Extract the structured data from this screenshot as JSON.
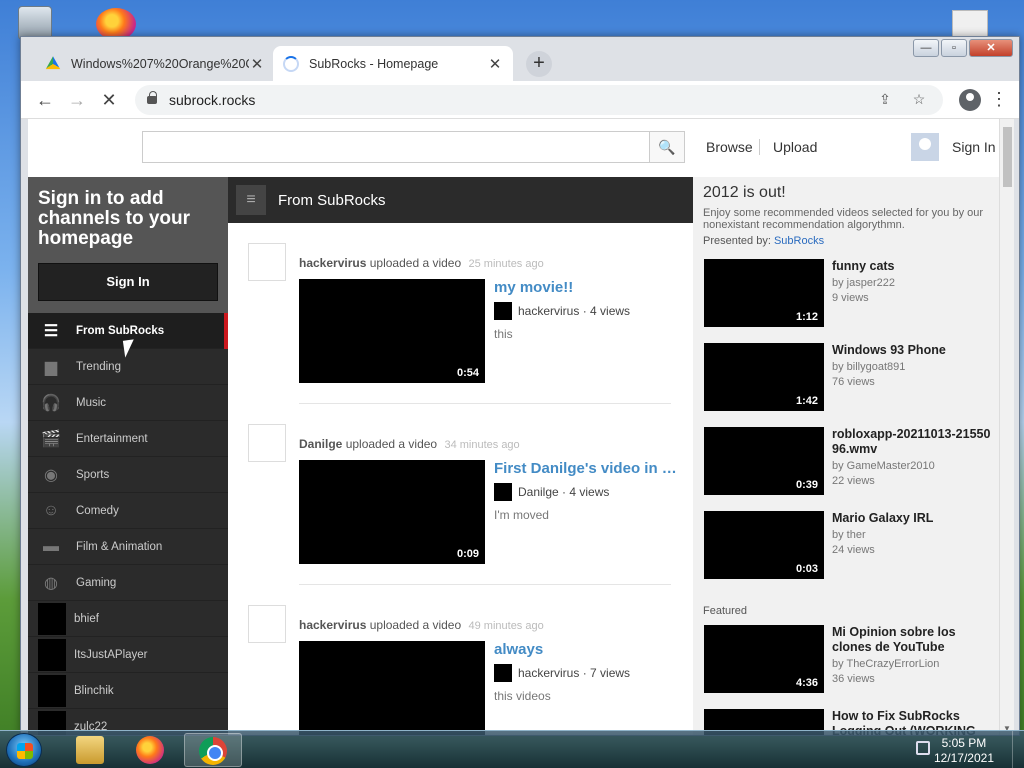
{
  "browser": {
    "tabs": [
      {
        "title": "Windows%207%20Orange%20C",
        "close": "✕"
      },
      {
        "title": "SubRocks - Homepage",
        "close": "✕"
      }
    ],
    "new_tab": "+",
    "url": "subrock.rocks",
    "back": "←",
    "forward": "→",
    "reload": "✕",
    "share": "⇪",
    "bookmark": "☆",
    "menu": "⋮",
    "window_controls": {
      "minimize": "—",
      "maximize": "▫",
      "close": "✕"
    }
  },
  "masthead": {
    "search_placeholder": "",
    "search_icon": "🔍",
    "browse": "Browse",
    "upload": "Upload",
    "sign_in": "Sign In"
  },
  "guide": {
    "heading": "Sign in to add channels to your homepage",
    "sign_in_button": "Sign In",
    "items": [
      {
        "label": "From SubRocks",
        "icon": "list-icon",
        "glyph": "☰"
      },
      {
        "label": "Trending",
        "icon": "trending-icon",
        "glyph": "▆"
      },
      {
        "label": "Music",
        "icon": "headphones-icon",
        "glyph": "🎧"
      },
      {
        "label": "Entertainment",
        "icon": "clapper-icon",
        "glyph": "🎬"
      },
      {
        "label": "Sports",
        "icon": "football-icon",
        "glyph": "◉"
      },
      {
        "label": "Comedy",
        "icon": "mask-icon",
        "glyph": "☺"
      },
      {
        "label": "Film & Animation",
        "icon": "film-icon",
        "glyph": "▬"
      },
      {
        "label": "Gaming",
        "icon": "gamepad-icon",
        "glyph": "◍"
      }
    ],
    "channels": [
      "bhief",
      "ItsJustAPlayer",
      "Blinchik",
      "zulc22"
    ]
  },
  "feed": {
    "title": "From SubRocks",
    "items": [
      {
        "user": "hackervirus",
        "action": "uploaded a video",
        "time": "25 minutes ago",
        "duration": "0:54",
        "title": "my movie!!",
        "author": "hackervirus",
        "views": "4 views",
        "description": "this"
      },
      {
        "user": "Danilge",
        "action": "uploaded a video",
        "time": "34 minutes ago",
        "duration": "0:09",
        "title": "First Danilge's video in SubRocks",
        "author": "Danilge",
        "views": "4 views",
        "description": "I'm moved"
      },
      {
        "user": "hackervirus",
        "action": "uploaded a video",
        "time": "49 minutes ago",
        "duration": "",
        "title": "always",
        "author": "hackervirus",
        "views": "7 views",
        "description": "this videos"
      }
    ]
  },
  "side": {
    "heading": "2012 is out!",
    "intro": "Enjoy some recommended videos selected for you by our nonexistant recommendation algorythmn.",
    "presented_label": "Presented by:",
    "presented_by": "SubRocks",
    "featured_label": "Featured",
    "recommended": [
      {
        "title": "funny cats",
        "by": "by jasper222",
        "views": "9 views",
        "duration": "1:12"
      },
      {
        "title": "Windows 93 Phone",
        "by": "by billygoat891",
        "views": "76 views",
        "duration": "1:42"
      },
      {
        "title": "robloxapp-20211013-2155096.wmv",
        "by": "by GameMaster2010",
        "views": "22 views",
        "duration": "0:39"
      },
      {
        "title": "Mario Galaxy IRL",
        "by": "by ther",
        "views": "24 views",
        "duration": "0:03"
      }
    ],
    "featured": [
      {
        "title": "Mi Opinion sobre los clones de YouTube",
        "by": "by TheCrazyErrorLion",
        "views": "36 views",
        "duration": "4:36"
      },
      {
        "title": "How to Fix SubRocks Logging Out (WORKING",
        "by": "",
        "views": "",
        "duration": ""
      }
    ]
  },
  "taskbar": {
    "time": "5:05 PM",
    "date": "12/17/2021"
  },
  "colors": {
    "link_blue": "#438bc5",
    "guide_bg": "#2b2b2b",
    "accent_red": "#cc181e"
  }
}
